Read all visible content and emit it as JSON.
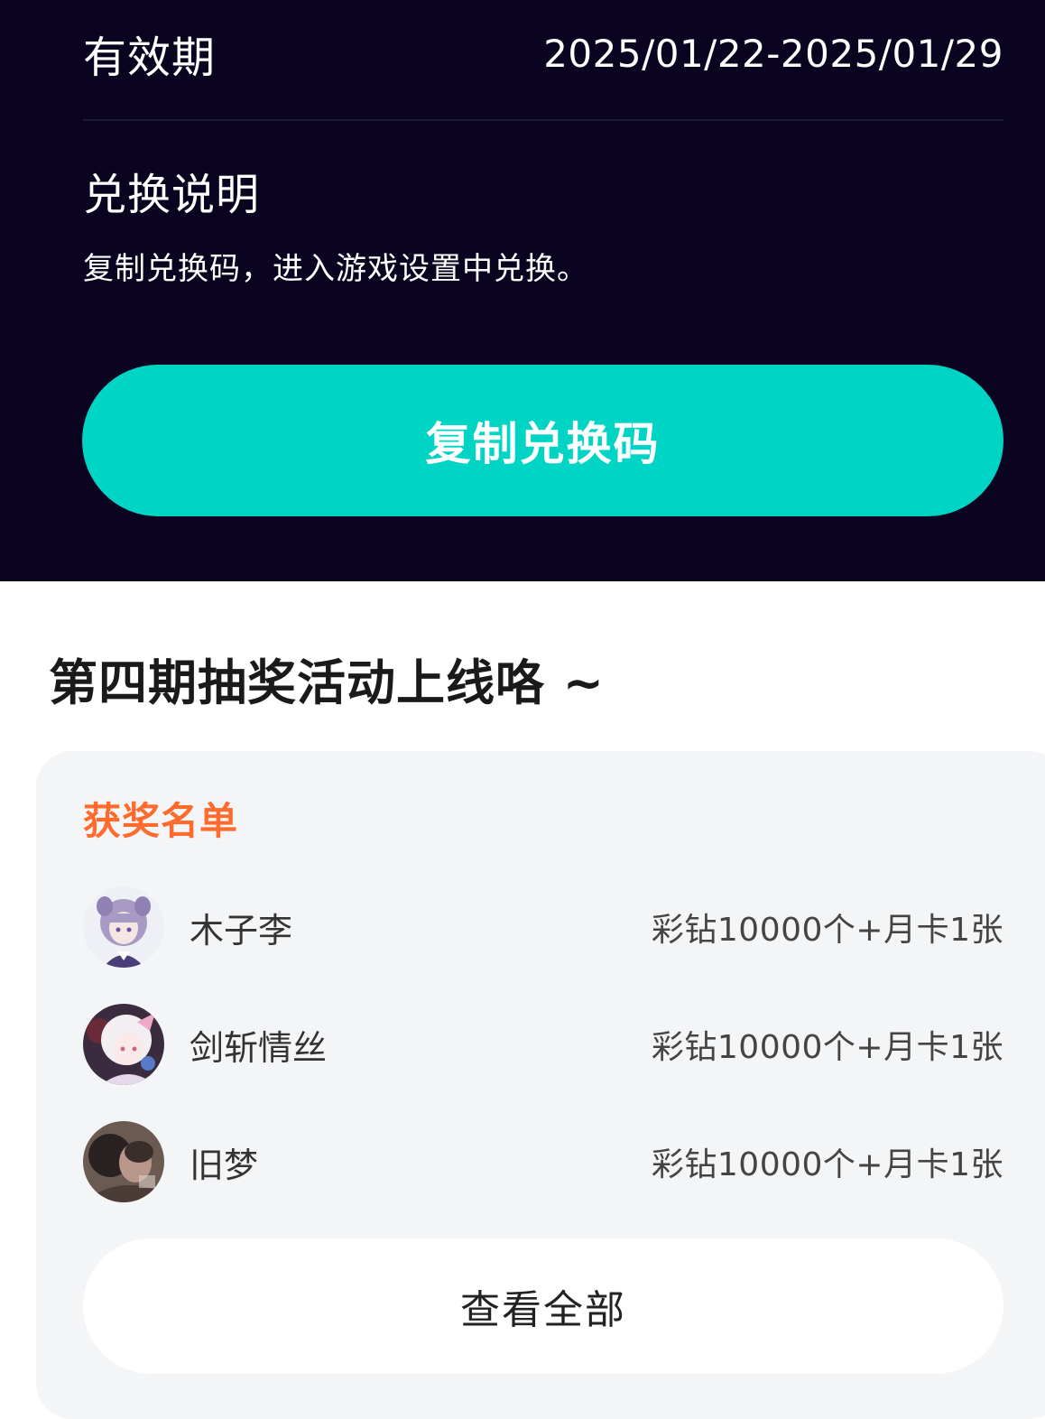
{
  "redeem": {
    "validity_label": "有效期",
    "validity_value": "2025/01/22-2025/01/29",
    "instructions_title": "兑换说明",
    "instructions_text": "复制兑换码，进入游戏设置中兑换。",
    "copy_button_label": "复制兑换码"
  },
  "event": {
    "title": "第四期抽奖活动上线咯 ~"
  },
  "winners": {
    "title": "获奖名单",
    "items": [
      {
        "name": "木子李",
        "prize": "彩钻10000个+月卡1张",
        "avatar": "anime-girl-purple-hair-avatar"
      },
      {
        "name": "剑斩情丝",
        "prize": "彩钻10000个+月卡1张",
        "avatar": "anime-girl-white-hair-avatar"
      },
      {
        "name": "旧梦",
        "prize": "彩钻10000个+月卡1张",
        "avatar": "photo-dark-avatar"
      }
    ],
    "view_all_label": "查看全部"
  },
  "colors": {
    "top_background": "#0a0420",
    "accent_teal": "#00d5c5",
    "winners_title": "#ff6a2d",
    "card_background": "#f4f5f7"
  }
}
